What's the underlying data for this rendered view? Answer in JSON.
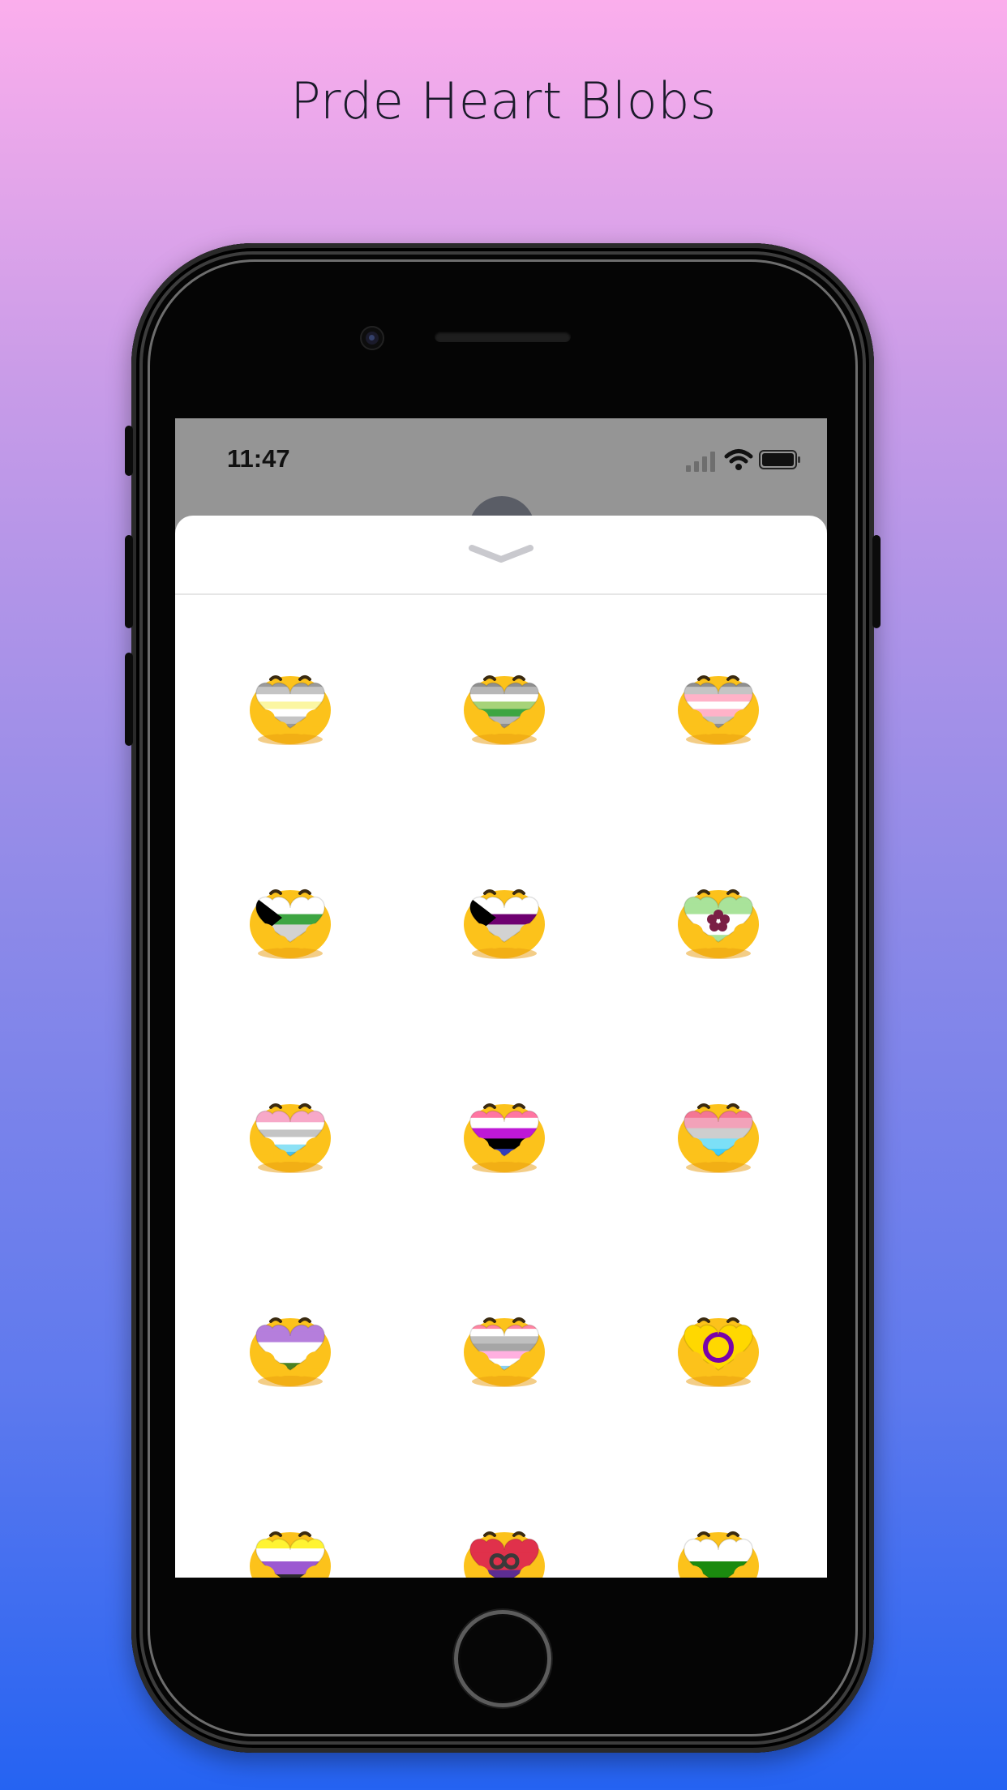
{
  "headline": "Prde Heart Blobs",
  "status_bar": {
    "time": "11:47"
  },
  "colors": {
    "blob": "#fcc21b",
    "blob_shadow": "#e89b10"
  },
  "stickers": [
    {
      "name": "sticker-agender-heart",
      "stripes": [
        "#9a9a9a",
        "#c4c4c4",
        "#ffffff",
        "#fbf6a2",
        "#ffffff",
        "#c4c4c4",
        "#9a9a9a"
      ]
    },
    {
      "name": "sticker-aromantic-heart",
      "stripes": [
        "#8f8f8f",
        "#b7b7b7",
        "#ffffff",
        "#a7d379",
        "#3da542",
        "#b7b7b7",
        "#8f8f8f"
      ]
    },
    {
      "name": "sticker-demigirl-heart",
      "stripes": [
        "#8f8f8f",
        "#c4c4c4",
        "#ffb2c8",
        "#ffffff",
        "#ffb2c8",
        "#c4c4c4",
        "#8f8f8f"
      ]
    },
    {
      "name": "sticker-demiromantic-heart",
      "stripes": [
        "#ffffff",
        "#ffffff",
        "#3da542",
        "#d2d2d2",
        "#d2d2d2"
      ],
      "chevron": "#000000"
    },
    {
      "name": "sticker-demisexual-heart",
      "stripes": [
        "#ffffff",
        "#ffffff",
        "#6e0070",
        "#d2d2d2",
        "#d2d2d2"
      ],
      "chevron": "#000000"
    },
    {
      "name": "sticker-sapphic-heart",
      "stripes": [
        "#a9e39a",
        "#a9e39a",
        "#ffffff",
        "#ffffff",
        "#a9e39a"
      ],
      "flower": "#7a1f45"
    },
    {
      "name": "sticker-genderfae-heart",
      "stripes": [
        "#f7a8c8",
        "#f7a8c8",
        "#ffffff",
        "#c4c4c4",
        "#ffffff",
        "#8ce1f5",
        "#4ac0e8"
      ]
    },
    {
      "name": "sticker-genderfluid-heart",
      "stripes": [
        "#ff75a2",
        "#ffffff",
        "#be18d6",
        "#000000",
        "#333ebd"
      ]
    },
    {
      "name": "sticker-genderflux-heart",
      "stripes": [
        "#f47694",
        "#f2a2b9",
        "#cecece",
        "#7ce0f7",
        "#3ecdf9"
      ]
    },
    {
      "name": "sticker-gender-queer-heart",
      "stripes": [
        "#b57edc",
        "#b57edc",
        "#ffffff",
        "#ffffff",
        "#4a8123"
      ]
    },
    {
      "name": "sticker-gray-demiboy-heart",
      "stripes": [
        "#ff85a2",
        "#ffffff",
        "#bfbfbf",
        "#a6a6a6",
        "#ffb0e0",
        "#ffffff",
        "#8ad0f0"
      ]
    },
    {
      "name": "sticker-intersex-heart",
      "stripes": [
        "#ffd800",
        "#ffd800",
        "#ffd800"
      ],
      "ring": "#7902aa"
    },
    {
      "name": "sticker-nonbinary-heart",
      "stripes": [
        "#fff433",
        "#ffffff",
        "#9c59d1",
        "#2c2c2c"
      ]
    },
    {
      "name": "sticker-polyamory-heart",
      "stripes": [
        "#e0314b",
        "#e0314b",
        "#5c2d91"
      ],
      "infinity": "#3a3a3a"
    },
    {
      "name": "sticker-green-heart",
      "stripes": [
        "#ffffff",
        "#ffffff",
        "#1b8a0f",
        "#1b8a0f"
      ]
    }
  ]
}
